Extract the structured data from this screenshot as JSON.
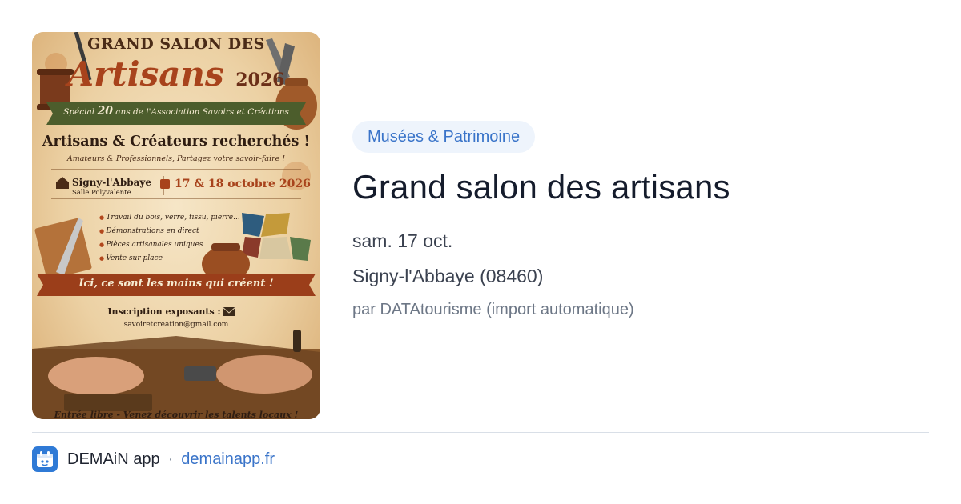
{
  "poster": {
    "top_line": "GRAND SALON DES",
    "title_word": "Artisans",
    "title_year": "2026",
    "ribbon_prefix": "Spécial",
    "ribbon_number": "20",
    "ribbon_rest": "ans de l'Association Savoirs et Créations",
    "headline": "Artisans & Créateurs recherchés !",
    "subline": "Amateurs & Professionnels, Partagez votre savoir-faire !",
    "town": "Signy-l'Abbaye",
    "hall": "Salle Polyvalente",
    "dates": "17 & 18 octobre 2026",
    "features": [
      "Travail du bois, verre, tissu, pierre...",
      "Démonstrations en direct",
      "Pièces artisanales uniques",
      "Vente sur place"
    ],
    "slogan": "Ici, ce sont les mains qui créent !",
    "registration": "Inscription exposants :",
    "email": "savoiretcreation@gmail.com",
    "footer": "Entrée libre - Venez découvrir les talents locaux !"
  },
  "event": {
    "category": "Musées & Patrimoine",
    "title": "Grand salon des artisans",
    "date": "sam. 17 oct.",
    "location": "Signy-l'Abbaye (08460)",
    "author": "par DATAtourisme (import automatique)"
  },
  "footer": {
    "app_name": "DEMAiN app",
    "separator": "·",
    "site": "demainapp.fr"
  },
  "colors": {
    "accent": "#3a74c9",
    "badge_bg": "#eef4fc",
    "app_icon_bg": "#2f7ad6"
  },
  "icons": [
    "envelope-icon",
    "house-icon",
    "calendar-icon",
    "app-logo-icon"
  ]
}
